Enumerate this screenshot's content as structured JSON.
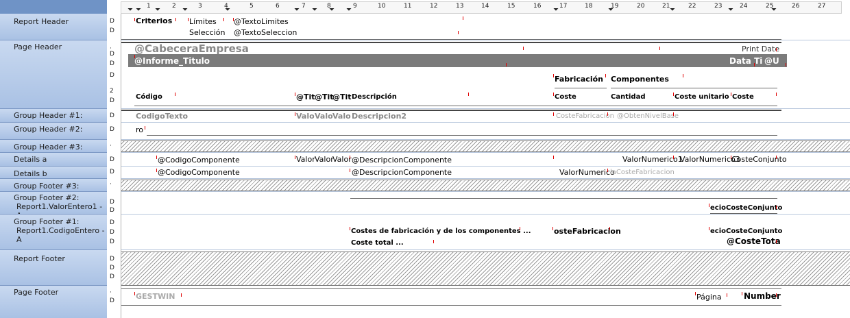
{
  "ruler": {
    "numbers": [
      "1",
      "2",
      "3",
      "4",
      "5",
      "6",
      "7",
      "8",
      "9",
      "10",
      "11",
      "12",
      "13",
      "14",
      "15",
      "16",
      "17",
      "18",
      "19",
      "20",
      "21",
      "22",
      "23",
      "24",
      "25",
      "26",
      "27"
    ],
    "tab_marker": "⏷"
  },
  "sections": {
    "report_header": "Report Header",
    "page_header": "Page Header",
    "group_header_1": "Group Header #1:",
    "group_header_2": "Group Header #2:",
    "group_header_3": "Group Header #3:",
    "details_a": "Details a",
    "details_b": "Details b",
    "group_footer_3": "Group Footer #3:",
    "group_footer_2": "Group Footer #2:",
    "group_footer_2_sub": "Report1.ValorEntero1 - A",
    "group_footer_1": "Group Footer #1:",
    "group_footer_1_sub": "Report1.CodigoEntero - A",
    "report_footer": "Report Footer",
    "page_footer": "Page Footer"
  },
  "gutter_glyphs": {
    "down": "D",
    "dot": "·",
    "mini": "2"
  },
  "report_header": {
    "criterios": "Criterios",
    "limites": "Límites",
    "seleccion": "Selección",
    "texto_limites": "@TextoLimites",
    "texto_seleccion": "@TextoSeleccion"
  },
  "page_header": {
    "cabecera_empresa": "@CabeceraEmpresa",
    "print_date": "Print Date",
    "informe_titulo": "@Informe_Titulo",
    "data_ti": "Data Ti",
    "at_u": "@U",
    "fabricacion": "Fabricación",
    "componentes": "Componentes",
    "codigo": "Código",
    "tit1": "@Tit",
    "tit2": "@Tit",
    "tit3": "@Tit",
    "descripcion": "Descripción",
    "coste": "Coste",
    "cantidad": "Cantidad",
    "coste_unitario": "Coste unitario",
    "coste2": "Coste"
  },
  "group_header_1": {
    "codigo_texto": "CodigoTexto",
    "valor1": "Valo",
    "valor2": "Valo",
    "valor3": "Valo",
    "descripcion2": "Descripcion2",
    "coste_fabricacion": "CosteFabricacion",
    "obten_nivel": "@ObtenNivelBase"
  },
  "group_header_2": {
    "ro": "ro"
  },
  "details_a": {
    "codigo_componente": "@CodigoComponente",
    "valor1": "Valor",
    "valor2": "Valor",
    "valor3": "Valor",
    "descripcion_componente": "@DescripcionComponente",
    "valor_numerico1": "ValorNumerico1",
    "valor_numerico3": "ValorNumerico3",
    "coste_conjunto": "CosteConjunto"
  },
  "details_b": {
    "codigo_componente": "@CodigoComponente",
    "descripcion_componente": "@DescripcionComponente",
    "valor_numerico": "ValorNumerico",
    "la_coste_fabricacion": "laCosteFabricacion"
  },
  "group_footer_2": {
    "ecio_coste": "ecioCosteConjunto"
  },
  "group_footer_1": {
    "costes_fab": "Costes de fabricación y de los componentes ...",
    "coste_total": "Coste total ...",
    "oste_fab": "osteFabricacion",
    "ecio_coste": "ecioCosteConjunto",
    "at_coste_total": "@CosteTota"
  },
  "page_footer": {
    "gestwin": "GESTWIN",
    "pagina": "Página",
    "number": "Number"
  }
}
